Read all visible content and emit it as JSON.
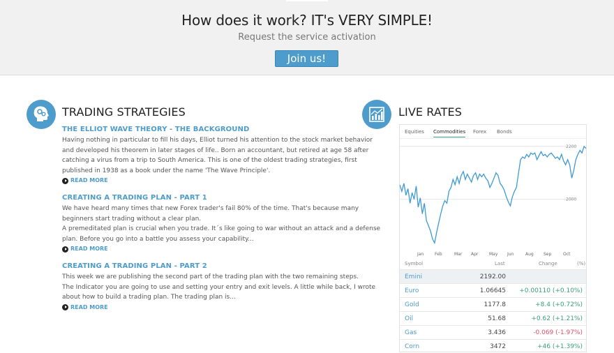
{
  "hero": {
    "title": "How does it work? IT's VERY SIMPLE!",
    "subtitle": "Request the service activation",
    "cta_label": "Join us!"
  },
  "strategies": {
    "heading": "TRADING STRATEGIES",
    "articles": [
      {
        "title": "THE ELLIOT WAVE THEORY - THE BACKGROUND",
        "lines": [
          "Having nothing in particular to fill his days, Elliot turned his attention to the stock market behavior",
          "and developed his theorem in later stages of life.. Born an accountant, but retired at age 58 after",
          "catching a virus from a trip to South America. This is one of the oldest trading strategies, first",
          "published in 1938 as a book under the name 'The Wave Principle'."
        ],
        "read_more": "READ MORE"
      },
      {
        "title": "CREATING A TRADING PLAN - PART 1",
        "lines": [
          "We have heard many times that new Forex trader's fail 80% of the time. That's because many",
          "beginners start trading without a clear plan.",
          "A premeditated plan is crucial when you trade. It´s like going to war without an attack and a defense",
          "plan. Before you go into a battle you assess your capability..."
        ],
        "read_more": "READ MORE"
      },
      {
        "title": "CREATING A TRADING PLAN - PART 2",
        "lines": [
          "This week we are publishing the second part of the trading plan with the two remaining steps.",
          "The Indicator you are going to use and setting your entry and exit levels. A little while back, I wrote",
          "about how to build a trading plan. The trading plan is..."
        ],
        "read_more": "READ MORE"
      }
    ]
  },
  "live_rates": {
    "heading": "LIVE RATES",
    "tabs": [
      "Equities",
      "Commodities",
      "Forex",
      "Bonds"
    ],
    "active_tab": "Commodities",
    "columns": {
      "symbol": "Symbol",
      "last": "Last",
      "change": "Change",
      "pct": "(%)"
    },
    "rows": [
      {
        "symbol": "Emini",
        "last": "2192.00",
        "change": "",
        "direction": "none",
        "selected": true
      },
      {
        "symbol": "Euro",
        "last": "1.06645",
        "change": "+0.00110 (+0.10%)",
        "direction": "up"
      },
      {
        "symbol": "Gold",
        "last": "1177.8",
        "change": "+8.4 (+0.72%)",
        "direction": "up"
      },
      {
        "symbol": "Oil",
        "last": "51.68",
        "change": "+0.62 (+1.21%)",
        "direction": "up"
      },
      {
        "symbol": "Gas",
        "last": "3.436",
        "change": "-0.069 (-1.97%)",
        "direction": "down"
      },
      {
        "symbol": "Corn",
        "last": "3472",
        "change": "+46 (+1.39%)",
        "direction": "up"
      }
    ],
    "colors": {
      "up": "#3aa07a",
      "down": "#e0506a",
      "accent": "#4d9ccb",
      "line": "#3d9ad6"
    }
  },
  "chart_data": {
    "type": "line",
    "title": "",
    "xlabel": "",
    "ylabel": "",
    "x_ticks": [
      "Jan",
      "Feb",
      "Mar",
      "Apr",
      "May",
      "Jun",
      "Aug",
      "Sep",
      "Oct"
    ],
    "y_ticks": [
      2000,
      2200
    ],
    "ylim": [
      1825,
      2210
    ],
    "series": [
      {
        "values": [
          2055,
          2030,
          2060,
          2015,
          2040,
          1985,
          2025,
          2000,
          2050,
          1970,
          2005,
          1945,
          1985,
          1920,
          1900,
          1880,
          1850,
          1835,
          1875,
          1910,
          1945,
          1975,
          1995,
          1985,
          2030,
          2045,
          2075,
          2055,
          2085,
          2060,
          2090,
          2105,
          2075,
          2095,
          2080,
          2065,
          2090,
          2100,
          2075,
          2095,
          2085,
          2095,
          2080,
          2070,
          2045,
          2060,
          2080,
          2100,
          2090,
          2060,
          2050,
          2035,
          2010,
          1990,
          1975,
          2010,
          2030,
          2045,
          2100,
          2150,
          2160,
          2155,
          2170,
          2160,
          2175,
          2170,
          2175,
          2150,
          2165,
          2180,
          2165,
          2170,
          2160,
          2170,
          2175,
          2165,
          2155,
          2160,
          2150,
          2170,
          2145,
          2130,
          2150,
          2130,
          2080,
          2110,
          2150,
          2170,
          2185,
          2175,
          2200,
          2192
        ]
      }
    ]
  }
}
